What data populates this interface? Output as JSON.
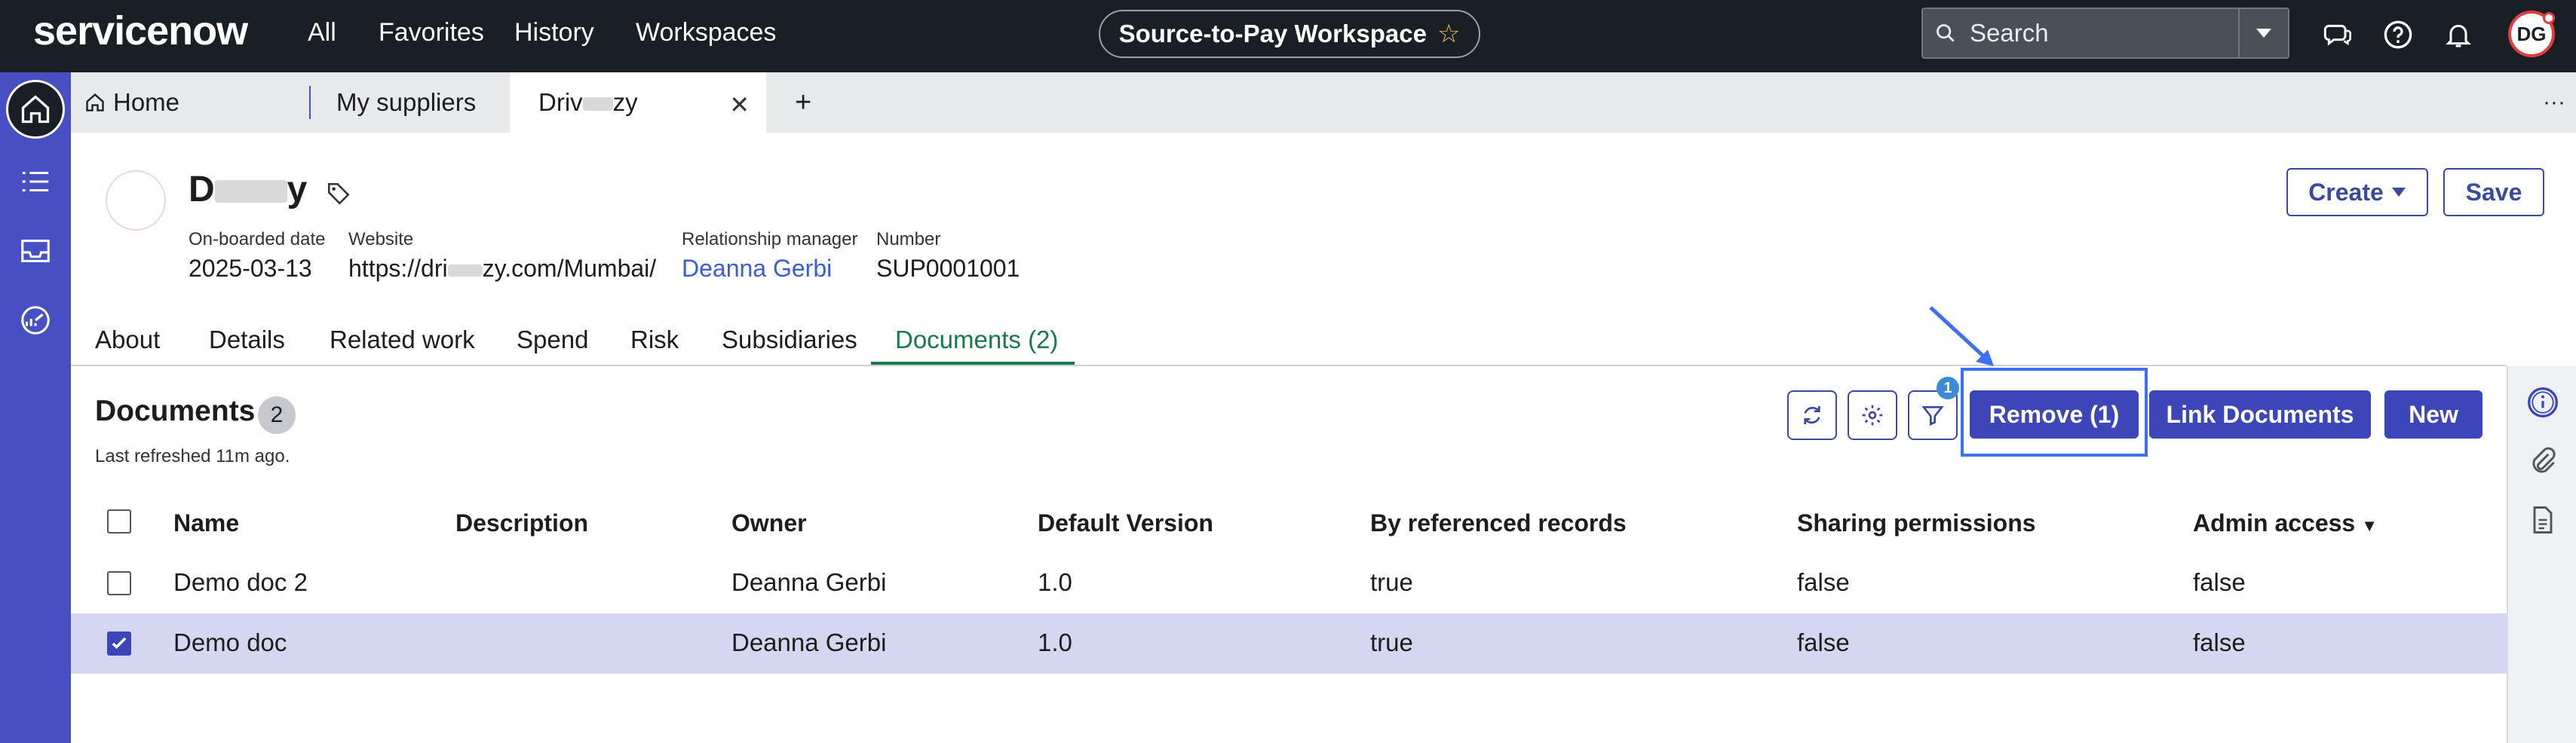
{
  "topbar": {
    "logo": "servicenow",
    "nav": [
      "All",
      "Favorites",
      "History",
      "Workspaces"
    ],
    "workspace": "Source-to-Pay Workspace",
    "search_placeholder": "Search",
    "avatar_initials": "DG"
  },
  "tabs": [
    {
      "label": "Home"
    },
    {
      "label": "My suppliers"
    },
    {
      "label": "Driv",
      "label_end": "zy"
    }
  ],
  "record": {
    "title_start": "D",
    "title_end": "y",
    "fields": [
      {
        "label": "On-boarded date",
        "value": "2025-03-13"
      },
      {
        "label": "Website",
        "value_start": "https://dri",
        "value_end": "zy.com/Mumbai/"
      },
      {
        "label": "Relationship manager",
        "value": "Deanna Gerbi"
      },
      {
        "label": "Number",
        "value": "SUP0001001"
      }
    ],
    "create_label": "Create",
    "save_label": "Save"
  },
  "subtabs": [
    "About",
    "Details",
    "Related work",
    "Spend",
    "Risk",
    "Subsidiaries",
    "Documents (2)"
  ],
  "documents": {
    "title": "Documents",
    "count": "2",
    "refreshed": "Last refreshed 11m ago.",
    "filter_badge": "1",
    "remove_label": "Remove (1)",
    "link_label": "Link Documents",
    "new_label": "New",
    "columns": [
      "Name",
      "Description",
      "Owner",
      "Default Version",
      "By referenced records",
      "Sharing permissions",
      "Admin access"
    ],
    "rows": [
      {
        "name": "Demo doc 2",
        "description": "",
        "owner": "Deanna Gerbi",
        "version": "1.0",
        "referenced": "true",
        "sharing": "false",
        "admin": "false",
        "selected": false
      },
      {
        "name": "Demo doc",
        "description": "",
        "owner": "Deanna Gerbi",
        "version": "1.0",
        "referenced": "true",
        "sharing": "false",
        "admin": "false",
        "selected": true
      }
    ]
  },
  "colors": {
    "topbar": "#1a1f26",
    "rail": "#4650c2",
    "primary_button": "#3c46b8",
    "active_subtab": "#167a4a",
    "link": "#3b5bdb",
    "selected_row": "#d5d7f1",
    "highlight": "#3e6ff5"
  }
}
